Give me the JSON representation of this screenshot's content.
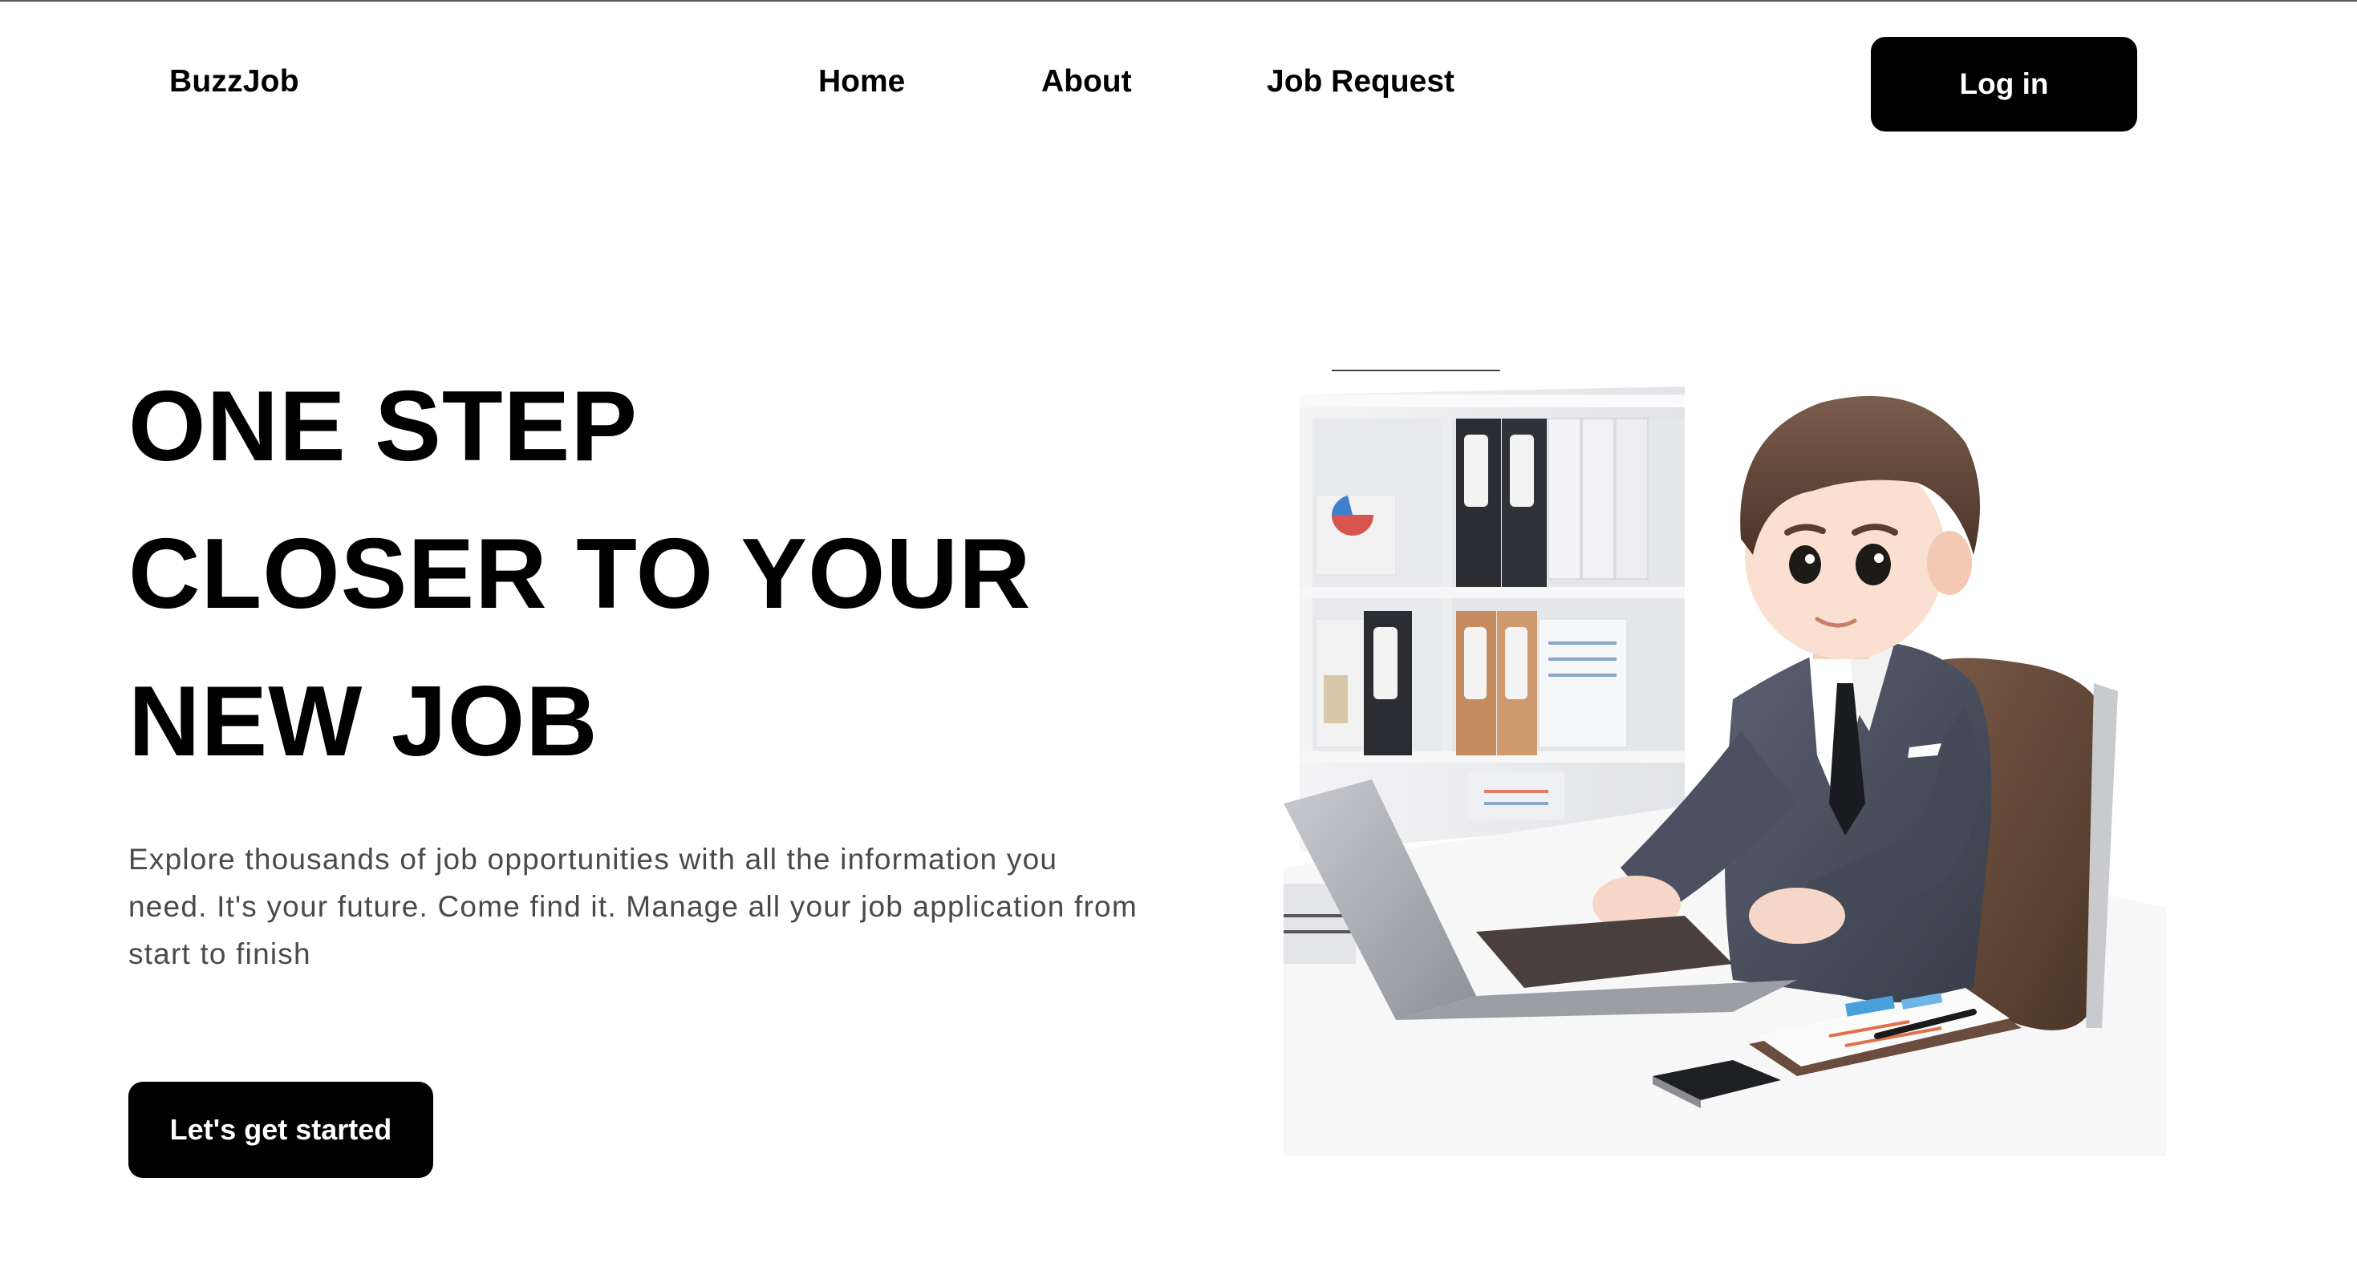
{
  "header": {
    "brand": "BuzzJob",
    "nav": [
      {
        "label": "Home"
      },
      {
        "label": "About"
      },
      {
        "label": "Job Request"
      }
    ],
    "login_label": "Log in"
  },
  "hero": {
    "title_lines": [
      "ONE STEP",
      "CLOSER TO YOUR",
      "NEW JOB"
    ],
    "description": "Explore thousands of job opportunities with all the information you need. It's your future. Come find it. Manage all your job application from start to finish",
    "cta_label": "Let's get started"
  },
  "illustration": {
    "subject": "businessman-at-laptop-illustration"
  },
  "colors": {
    "primary": "#000000",
    "background": "#ffffff",
    "body_text": "#4a4a4a"
  }
}
